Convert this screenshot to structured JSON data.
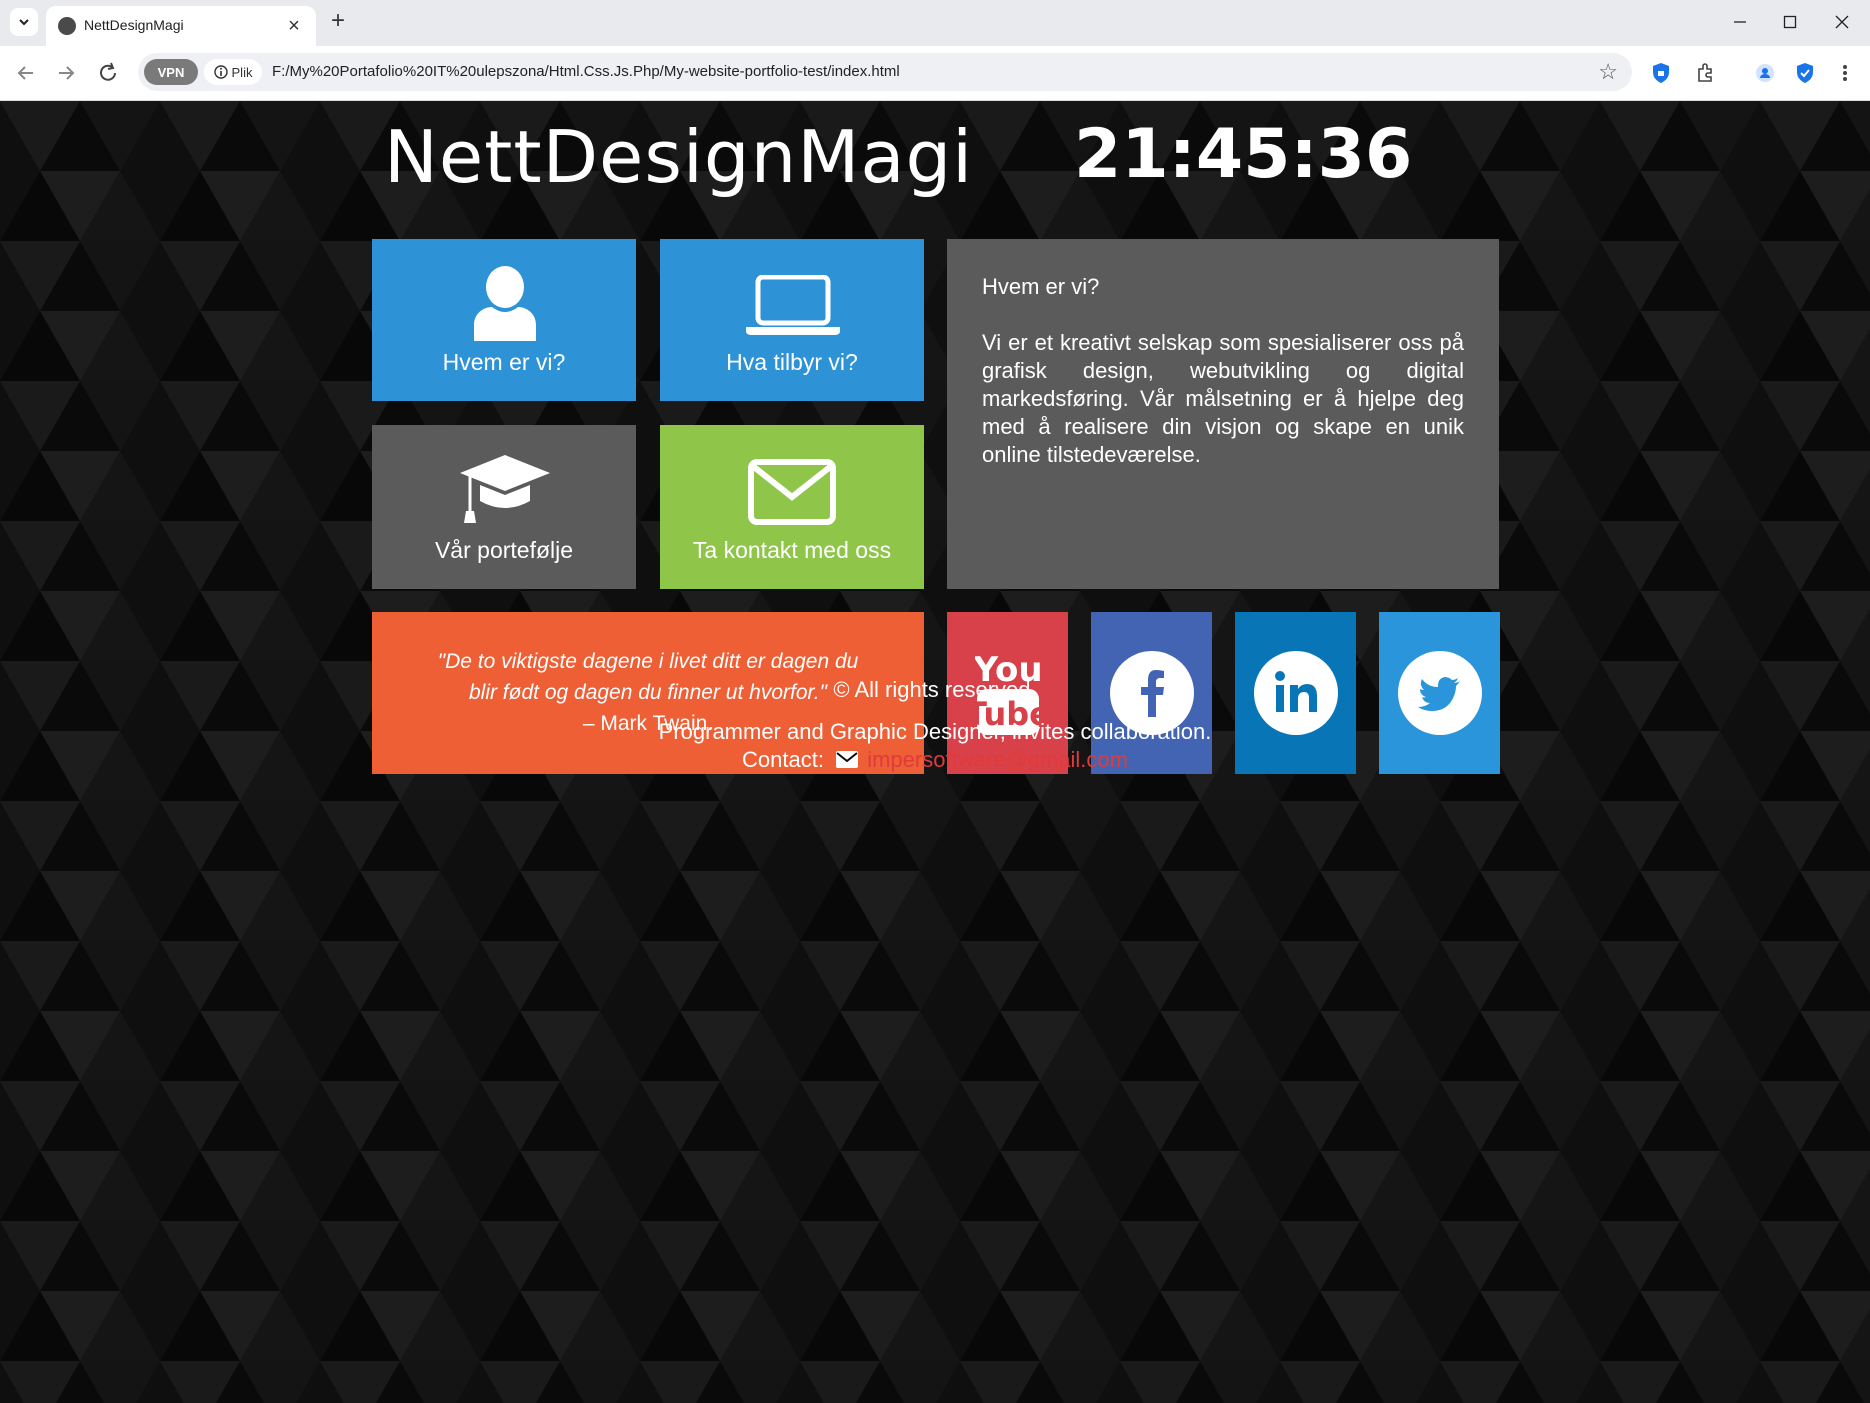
{
  "browser": {
    "tab_title": "NettDesignMagi",
    "vpn_label": "VPN",
    "site_info_label": "Plik",
    "url": "F:/My%20Portafolio%20IT%20ulepszona/Html.Css.Js.Php/My-website-portfolio-test/index.html"
  },
  "header": {
    "logo": "NettDesignMagi",
    "clock": "21:45:36"
  },
  "tiles": [
    {
      "label": "Hvem er vi?",
      "color": "#2d92d6",
      "icon": "user-icon"
    },
    {
      "label": "Hva tilbyr vi?",
      "color": "#2d92d6",
      "icon": "laptop-icon"
    },
    {
      "label": "Vår portefølje",
      "color": "#5b5b5b",
      "icon": "graduation-cap-icon"
    },
    {
      "label": "Ta kontakt med oss",
      "color": "#8fc549",
      "icon": "envelope-icon"
    }
  ],
  "about": {
    "title": "Hvem er vi?",
    "text": "Vi er et kreativt selskap som spesialiserer oss på grafisk design, webutvikling og digital markedsføring. Vår målsetning er å hjelpe deg med å realisere din visjon og skape en unik online tilstedeværelse."
  },
  "quote": {
    "text": "\"De to viktigste dagene i livet ditt er dagen du blir født og dagen du finner ut hvorfor.\"",
    "author": "– Mark Twain."
  },
  "social": [
    {
      "name": "youtube-icon",
      "color": "#d9414a",
      "yt_top": "You",
      "yt_bottom": "Tube"
    },
    {
      "name": "facebook-icon",
      "color": "#4264b3"
    },
    {
      "name": "linkedin-icon",
      "color": "#0875b7"
    },
    {
      "name": "twitter-icon",
      "color": "#2a95db"
    }
  ],
  "footer": {
    "rights": "© All rights reserved.",
    "tagline": "Programmer and Graphic Designer, invites collaboration.",
    "contact_label": "Contact:",
    "email": "impersoftware@gmail.com"
  }
}
